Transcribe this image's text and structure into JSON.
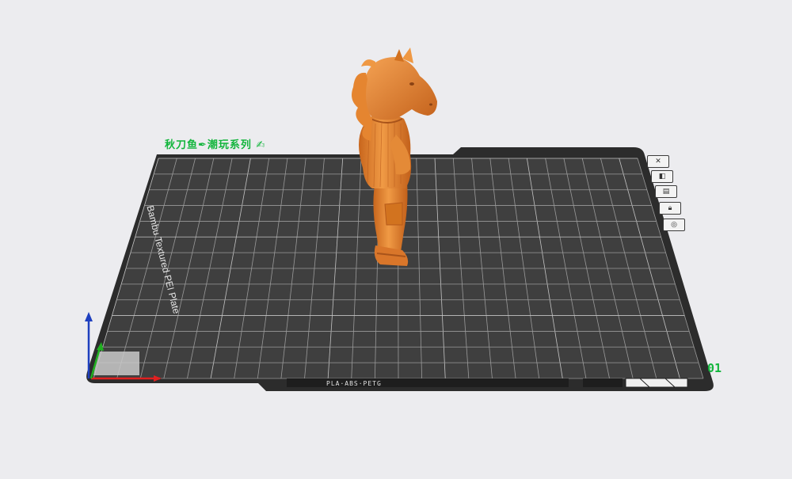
{
  "scene": {
    "plate_label": "秋刀鱼✒潮玩系列 ✍",
    "plate_number": "01",
    "bed_brand": "Bambu Textured PEI Plate",
    "bed_filament_text": "PLA·ABS·PETG",
    "model_color": "#e9852f",
    "bed_color": "#3a3a3a",
    "accent_color": "#12b53c",
    "axis_colors": {
      "x": "#e02020",
      "y": "#20b020",
      "z": "#1e3fbf"
    }
  },
  "plate_tools": [
    {
      "id": "delete",
      "icon": "close-icon"
    },
    {
      "id": "arrange",
      "icon": "arrange-icon"
    },
    {
      "id": "orient",
      "icon": "orient-icon"
    },
    {
      "id": "lock",
      "icon": "lock-icon"
    },
    {
      "id": "settings",
      "icon": "eye-settings-icon"
    }
  ]
}
